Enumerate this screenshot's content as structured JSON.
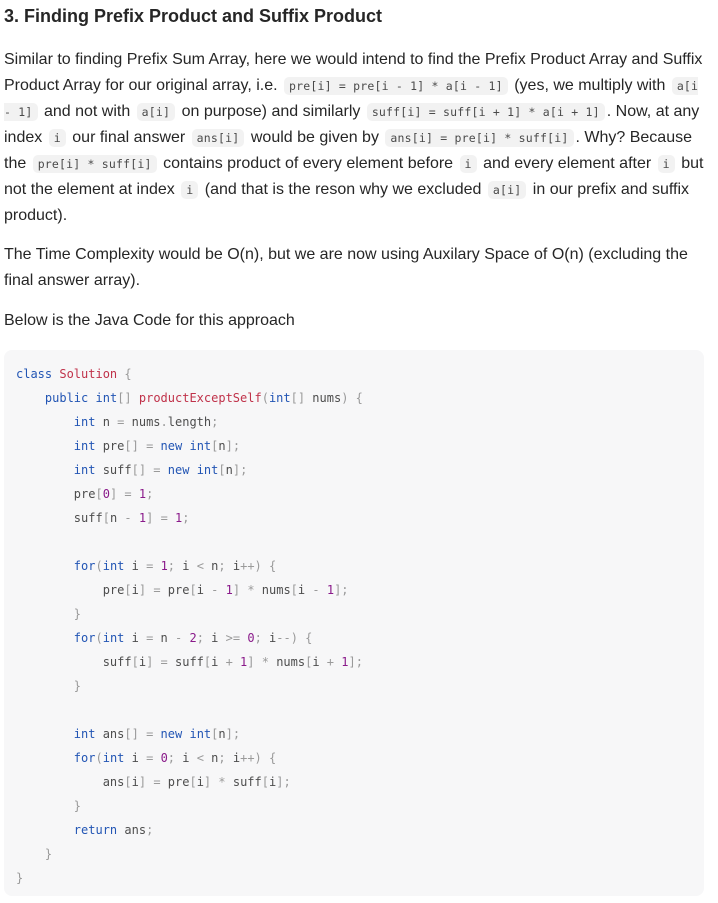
{
  "heading": "3. Finding Prefix Product and Suffix Product",
  "para1": {
    "t1": "Similar to finding Prefix Sum Array, here we would intend to find the Prefix Product Array and Suffix Product Array for our original array, i.e. ",
    "c1": "pre[i] = pre[i - 1] * a[i - 1]",
    "t2": " (yes, we multiply with ",
    "c2": "a[i - 1]",
    "t3": " and not with ",
    "c3": "a[i]",
    "t4": " on purpose) and similarly ",
    "c4": "suff[i] = suff[i + 1] * a[i + 1]",
    "t5": ". Now, at any index ",
    "c5": "i",
    "t6": " our final answer ",
    "c6": "ans[i]",
    "t7": " would be given by ",
    "c7": "ans[i] = pre[i] * suff[i]",
    "t8": ". Why? Because the ",
    "c8": "pre[i] * suff[i]",
    "t9": " contains product of every element before ",
    "c9": "i",
    "t10": " and every element after ",
    "c10": "i",
    "t11": " but not the element at index ",
    "c11": "i",
    "t12": " (and that is the reson why we excluded ",
    "c12": "a[i]",
    "t13": " in our prefix and suffix product)."
  },
  "para2": "The Time Complexity would be O(n), but we are now using Auxilary Space of O(n) (excluding the final answer array).",
  "para3": "Below is the Java Code for this approach",
  "code": {
    "language": "java",
    "lines": [
      [
        [
          "kw",
          "class"
        ],
        [
          "t",
          " "
        ],
        [
          "cl",
          "Solution"
        ],
        [
          "t",
          " "
        ],
        [
          "pn",
          "{"
        ]
      ],
      [
        [
          "t",
          "    "
        ],
        [
          "kw",
          "public"
        ],
        [
          "t",
          " "
        ],
        [
          "kw",
          "int"
        ],
        [
          "pn",
          "[]"
        ],
        [
          "t",
          " "
        ],
        [
          "cl",
          "productExceptSelf"
        ],
        [
          "pn",
          "("
        ],
        [
          "kw",
          "int"
        ],
        [
          "pn",
          "[]"
        ],
        [
          "t",
          " nums"
        ],
        [
          "pn",
          ")"
        ],
        [
          "t",
          " "
        ],
        [
          "pn",
          "{"
        ]
      ],
      [
        [
          "t",
          "        "
        ],
        [
          "kw",
          "int"
        ],
        [
          "t",
          " n "
        ],
        [
          "op",
          "="
        ],
        [
          "t",
          " nums"
        ],
        [
          "op",
          "."
        ],
        [
          "t",
          "length"
        ],
        [
          "pn",
          ";"
        ]
      ],
      [
        [
          "t",
          "        "
        ],
        [
          "kw",
          "int"
        ],
        [
          "t",
          " pre"
        ],
        [
          "pn",
          "[]"
        ],
        [
          "t",
          " "
        ],
        [
          "op",
          "="
        ],
        [
          "t",
          " "
        ],
        [
          "kw",
          "new"
        ],
        [
          "t",
          " "
        ],
        [
          "kw",
          "int"
        ],
        [
          "pn",
          "["
        ],
        [
          "t",
          "n"
        ],
        [
          "pn",
          "];"
        ]
      ],
      [
        [
          "t",
          "        "
        ],
        [
          "kw",
          "int"
        ],
        [
          "t",
          " suff"
        ],
        [
          "pn",
          "[]"
        ],
        [
          "t",
          " "
        ],
        [
          "op",
          "="
        ],
        [
          "t",
          " "
        ],
        [
          "kw",
          "new"
        ],
        [
          "t",
          " "
        ],
        [
          "kw",
          "int"
        ],
        [
          "pn",
          "["
        ],
        [
          "t",
          "n"
        ],
        [
          "pn",
          "];"
        ]
      ],
      [
        [
          "t",
          "        pre"
        ],
        [
          "pn",
          "["
        ],
        [
          "num",
          "0"
        ],
        [
          "pn",
          "]"
        ],
        [
          "t",
          " "
        ],
        [
          "op",
          "="
        ],
        [
          "t",
          " "
        ],
        [
          "num",
          "1"
        ],
        [
          "pn",
          ";"
        ]
      ],
      [
        [
          "t",
          "        suff"
        ],
        [
          "pn",
          "["
        ],
        [
          "t",
          "n "
        ],
        [
          "op",
          "-"
        ],
        [
          "t",
          " "
        ],
        [
          "num",
          "1"
        ],
        [
          "pn",
          "]"
        ],
        [
          "t",
          " "
        ],
        [
          "op",
          "="
        ],
        [
          "t",
          " "
        ],
        [
          "num",
          "1"
        ],
        [
          "pn",
          ";"
        ]
      ],
      [],
      [
        [
          "t",
          "        "
        ],
        [
          "kw",
          "for"
        ],
        [
          "pn",
          "("
        ],
        [
          "kw",
          "int"
        ],
        [
          "t",
          " i "
        ],
        [
          "op",
          "="
        ],
        [
          "t",
          " "
        ],
        [
          "num",
          "1"
        ],
        [
          "pn",
          ";"
        ],
        [
          "t",
          " i "
        ],
        [
          "op",
          "<"
        ],
        [
          "t",
          " n"
        ],
        [
          "pn",
          ";"
        ],
        [
          "t",
          " i"
        ],
        [
          "op",
          "++"
        ],
        [
          "pn",
          ")"
        ],
        [
          "t",
          " "
        ],
        [
          "pn",
          "{"
        ]
      ],
      [
        [
          "t",
          "            pre"
        ],
        [
          "pn",
          "["
        ],
        [
          "t",
          "i"
        ],
        [
          "pn",
          "]"
        ],
        [
          "t",
          " "
        ],
        [
          "op",
          "="
        ],
        [
          "t",
          " pre"
        ],
        [
          "pn",
          "["
        ],
        [
          "t",
          "i "
        ],
        [
          "op",
          "-"
        ],
        [
          "t",
          " "
        ],
        [
          "num",
          "1"
        ],
        [
          "pn",
          "]"
        ],
        [
          "t",
          " "
        ],
        [
          "op",
          "*"
        ],
        [
          "t",
          " nums"
        ],
        [
          "pn",
          "["
        ],
        [
          "t",
          "i "
        ],
        [
          "op",
          "-"
        ],
        [
          "t",
          " "
        ],
        [
          "num",
          "1"
        ],
        [
          "pn",
          "];"
        ]
      ],
      [
        [
          "t",
          "        "
        ],
        [
          "pn",
          "}"
        ]
      ],
      [
        [
          "t",
          "        "
        ],
        [
          "kw",
          "for"
        ],
        [
          "pn",
          "("
        ],
        [
          "kw",
          "int"
        ],
        [
          "t",
          " i "
        ],
        [
          "op",
          "="
        ],
        [
          "t",
          " n "
        ],
        [
          "op",
          "-"
        ],
        [
          "t",
          " "
        ],
        [
          "num",
          "2"
        ],
        [
          "pn",
          ";"
        ],
        [
          "t",
          " i "
        ],
        [
          "op",
          ">="
        ],
        [
          "t",
          " "
        ],
        [
          "num",
          "0"
        ],
        [
          "pn",
          ";"
        ],
        [
          "t",
          " i"
        ],
        [
          "op",
          "--"
        ],
        [
          "pn",
          ")"
        ],
        [
          "t",
          " "
        ],
        [
          "pn",
          "{"
        ]
      ],
      [
        [
          "t",
          "            suff"
        ],
        [
          "pn",
          "["
        ],
        [
          "t",
          "i"
        ],
        [
          "pn",
          "]"
        ],
        [
          "t",
          " "
        ],
        [
          "op",
          "="
        ],
        [
          "t",
          " suff"
        ],
        [
          "pn",
          "["
        ],
        [
          "t",
          "i "
        ],
        [
          "op",
          "+"
        ],
        [
          "t",
          " "
        ],
        [
          "num",
          "1"
        ],
        [
          "pn",
          "]"
        ],
        [
          "t",
          " "
        ],
        [
          "op",
          "*"
        ],
        [
          "t",
          " nums"
        ],
        [
          "pn",
          "["
        ],
        [
          "t",
          "i "
        ],
        [
          "op",
          "+"
        ],
        [
          "t",
          " "
        ],
        [
          "num",
          "1"
        ],
        [
          "pn",
          "];"
        ]
      ],
      [
        [
          "t",
          "        "
        ],
        [
          "pn",
          "}"
        ]
      ],
      [],
      [
        [
          "t",
          "        "
        ],
        [
          "kw",
          "int"
        ],
        [
          "t",
          " ans"
        ],
        [
          "pn",
          "[]"
        ],
        [
          "t",
          " "
        ],
        [
          "op",
          "="
        ],
        [
          "t",
          " "
        ],
        [
          "kw",
          "new"
        ],
        [
          "t",
          " "
        ],
        [
          "kw",
          "int"
        ],
        [
          "pn",
          "["
        ],
        [
          "t",
          "n"
        ],
        [
          "pn",
          "];"
        ]
      ],
      [
        [
          "t",
          "        "
        ],
        [
          "kw",
          "for"
        ],
        [
          "pn",
          "("
        ],
        [
          "kw",
          "int"
        ],
        [
          "t",
          " i "
        ],
        [
          "op",
          "="
        ],
        [
          "t",
          " "
        ],
        [
          "num",
          "0"
        ],
        [
          "pn",
          ";"
        ],
        [
          "t",
          " i "
        ],
        [
          "op",
          "<"
        ],
        [
          "t",
          " n"
        ],
        [
          "pn",
          ";"
        ],
        [
          "t",
          " i"
        ],
        [
          "op",
          "++"
        ],
        [
          "pn",
          ")"
        ],
        [
          "t",
          " "
        ],
        [
          "pn",
          "{"
        ]
      ],
      [
        [
          "t",
          "            ans"
        ],
        [
          "pn",
          "["
        ],
        [
          "t",
          "i"
        ],
        [
          "pn",
          "]"
        ],
        [
          "t",
          " "
        ],
        [
          "op",
          "="
        ],
        [
          "t",
          " pre"
        ],
        [
          "pn",
          "["
        ],
        [
          "t",
          "i"
        ],
        [
          "pn",
          "]"
        ],
        [
          "t",
          " "
        ],
        [
          "op",
          "*"
        ],
        [
          "t",
          " suff"
        ],
        [
          "pn",
          "["
        ],
        [
          "t",
          "i"
        ],
        [
          "pn",
          "];"
        ]
      ],
      [
        [
          "t",
          "        "
        ],
        [
          "pn",
          "}"
        ]
      ],
      [
        [
          "t",
          "        "
        ],
        [
          "kw",
          "return"
        ],
        [
          "t",
          " ans"
        ],
        [
          "pn",
          ";"
        ]
      ],
      [
        [
          "t",
          "    "
        ],
        [
          "pn",
          "}"
        ]
      ],
      [
        [
          "pn",
          "}"
        ]
      ]
    ]
  }
}
